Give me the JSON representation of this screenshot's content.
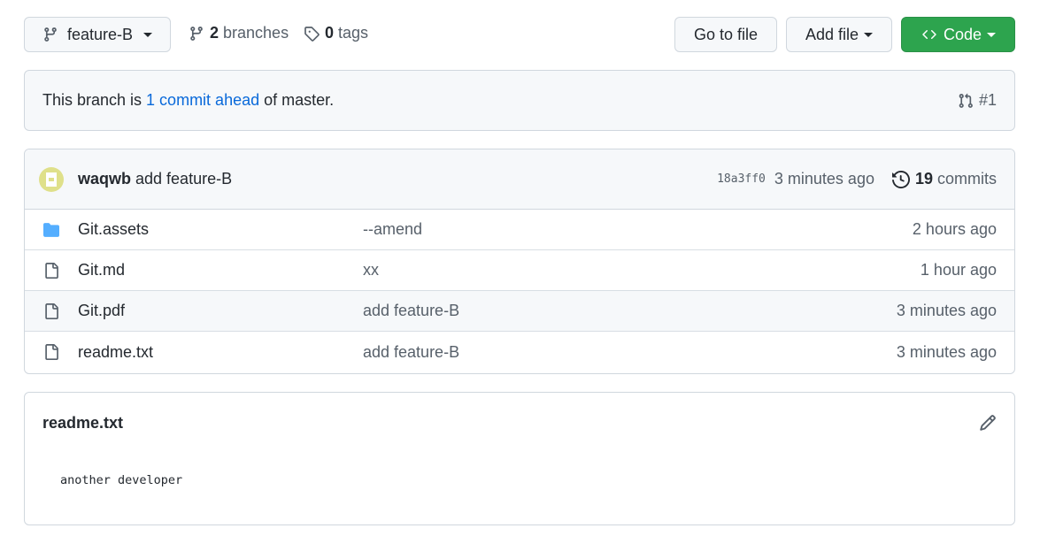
{
  "toolbar": {
    "branch": "feature-B",
    "branches_count": "2",
    "branches_label": "branches",
    "tags_count": "0",
    "tags_label": "tags",
    "goto_file": "Go to file",
    "add_file": "Add file",
    "code": "Code"
  },
  "ahead": {
    "prefix": "This branch is ",
    "link": "1 commit ahead",
    "suffix": " of master.",
    "pr": "#1"
  },
  "latest_commit": {
    "author": "waqwb",
    "message": "add feature-B",
    "sha": "18a3ff0",
    "time": "3 minutes ago",
    "commits_count": "19",
    "commits_label": "commits"
  },
  "files": [
    {
      "name": "Git.assets",
      "type": "folder",
      "message": "--amend",
      "age": "2 hours ago"
    },
    {
      "name": "Git.md",
      "type": "file",
      "message": "xx",
      "age": "1 hour ago"
    },
    {
      "name": "Git.pdf",
      "type": "file",
      "message": "add feature-B",
      "age": "3 minutes ago"
    },
    {
      "name": "readme.txt",
      "type": "file",
      "message": "add feature-B",
      "age": "3 minutes ago"
    }
  ],
  "readme": {
    "title": "readme.txt",
    "content": "another developer"
  },
  "colors": {
    "link": "#0969da",
    "primary_button": "#2da44e",
    "folder_icon": "#54aeff"
  }
}
